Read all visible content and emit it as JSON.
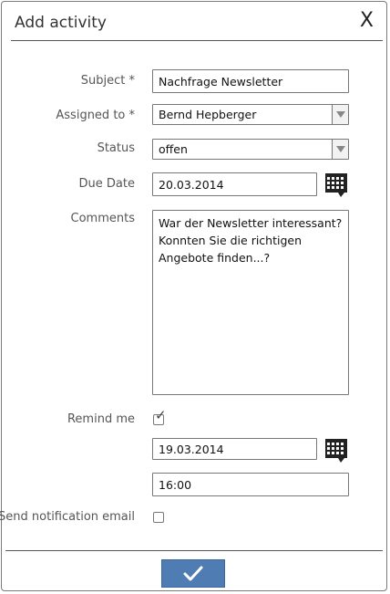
{
  "dialog": {
    "title": "Add activity",
    "close_label": "X"
  },
  "form": {
    "subject": {
      "label": "Subject *",
      "value": "Nachfrage Newsletter"
    },
    "assigned_to": {
      "label": "Assigned to *",
      "value": "Bernd Hepberger"
    },
    "status": {
      "label": "Status",
      "value": "offen"
    },
    "due_date": {
      "label": "Due Date",
      "value": "20.03.2014"
    },
    "comments": {
      "label": "Comments",
      "value": "War der Newsletter interessant? Konnten Sie die richtigen Angebote finden...?"
    },
    "remind_me": {
      "label": "Remind me",
      "checked": true
    },
    "remind_date": {
      "value": "19.03.2014"
    },
    "remind_time": {
      "value": "16:00"
    },
    "send_notification": {
      "label": "Send notification email",
      "checked": false
    }
  },
  "icons": {
    "close": "close-icon",
    "calendar": "calendar-icon",
    "dropdown": "chevron-down-icon",
    "submit": "checkmark-icon"
  },
  "colors": {
    "submit_button": "#4f7db3",
    "border": "#777777"
  }
}
